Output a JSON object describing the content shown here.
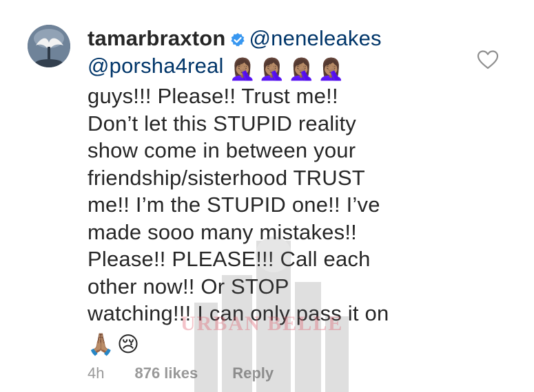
{
  "comment": {
    "username": "tamarbraxton",
    "mentions": [
      "@neneleakes",
      "@porsha4real"
    ],
    "emoji_facepalm": [
      "🤦🏽‍♀️",
      "🤦🏽‍♀️",
      "🤦🏽‍♀️",
      "🤦🏽‍♀️"
    ],
    "lines": [
      "guys!!! Please!! Trust me!!",
      "Don’t let this STUPID reality",
      "show come in between your",
      "friendship/sisterhood TRUST",
      "me!! I’m the STUPID one!! I’ve",
      "made sooo many mistakes!!",
      "Please!! PLEASE!!! Call each",
      "other now!! Or STOP",
      "watching!!! I can only pass it on"
    ],
    "trailing_emoji": [
      "🙏🏽",
      "😢"
    ],
    "time": "4h",
    "likes": "876 likes",
    "reply_label": "Reply"
  },
  "watermark": {
    "text": "URBAN BELLE"
  },
  "icons": {
    "avatar": "profile-avatar",
    "verified": "verified-badge-icon",
    "heart": "heart-outline-icon"
  },
  "colors": {
    "text": "#262626",
    "mention": "#003569",
    "meta": "#999999",
    "verified": "#3897f0",
    "watermark": "#e05a6a"
  }
}
